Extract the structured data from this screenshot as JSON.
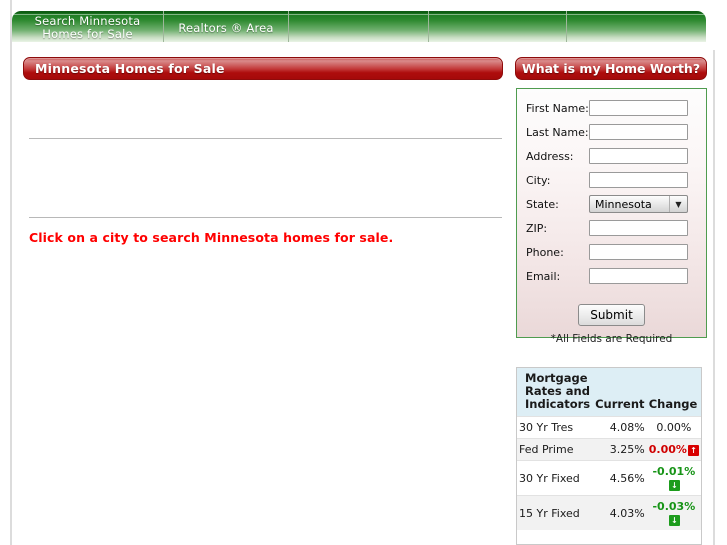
{
  "nav": {
    "items": [
      {
        "label": "Search Minnesota Homes for Sale",
        "name": "nav-item-search-homes"
      },
      {
        "label": "Realtors ® Area",
        "name": "nav-item-realtors-area"
      },
      {
        "label": "",
        "name": "nav-item-empty-3"
      },
      {
        "label": "",
        "name": "nav-item-empty-4"
      },
      {
        "label": "",
        "name": "nav-item-empty-5"
      }
    ]
  },
  "left": {
    "band_title": "Minnesota Homes for Sale",
    "instruction": "Click on a city to search Minnesota homes for sale."
  },
  "right": {
    "band_title": "What is my Home Worth?",
    "form": {
      "fields": [
        {
          "label": "First Name:",
          "value": "",
          "placeholder": "",
          "type": "text",
          "name": "first-name-field"
        },
        {
          "label": "Last Name:",
          "value": "",
          "placeholder": "",
          "type": "text",
          "name": "last-name-field"
        },
        {
          "label": "Address:",
          "value": "",
          "placeholder": "",
          "type": "text",
          "name": "address-field"
        },
        {
          "label": "City:",
          "value": "",
          "placeholder": "",
          "type": "text",
          "name": "city-field"
        },
        {
          "label": "State:",
          "value": "Minnesota",
          "placeholder": "",
          "type": "select",
          "name": "state-select"
        },
        {
          "label": "ZIP:",
          "value": "",
          "placeholder": "",
          "type": "text",
          "name": "zip-field"
        },
        {
          "label": "Phone:",
          "value": "",
          "placeholder": "",
          "type": "text",
          "name": "phone-field"
        },
        {
          "label": "Email:",
          "value": "",
          "placeholder": "",
          "type": "text",
          "name": "email-field"
        }
      ],
      "submit_label": "Submit",
      "required_note": "*All Fields are Required",
      "dropdown_arrow_glyph": "▼"
    },
    "rates": {
      "header_name": "Mortgage Rates and Indicators",
      "header_current": "Current",
      "header_change": "Change",
      "rows": [
        {
          "name": "30 Yr Tres",
          "current": "4.08%",
          "change": "0.00%",
          "direction": "none",
          "arrow": ""
        },
        {
          "name": "Fed Prime",
          "current": "3.25%",
          "change": "0.00%",
          "direction": "up",
          "arrow": "↑"
        },
        {
          "name": "30 Yr Fixed",
          "current": "4.56%",
          "change": "-0.01%",
          "direction": "down",
          "arrow": "↓"
        },
        {
          "name": "15 Yr Fixed",
          "current": "4.03%",
          "change": "-0.03%",
          "direction": "down",
          "arrow": "↓"
        }
      ]
    }
  },
  "colors": {
    "nav_green_dark": "#0d5c12",
    "band_red": "#a50a0a",
    "instruction_red": "#ff0000",
    "form_border_green": "#4f9c4f",
    "table_header_blue": "#ddeef5",
    "change_up_red": "#d00000",
    "change_down_green": "#179417"
  }
}
